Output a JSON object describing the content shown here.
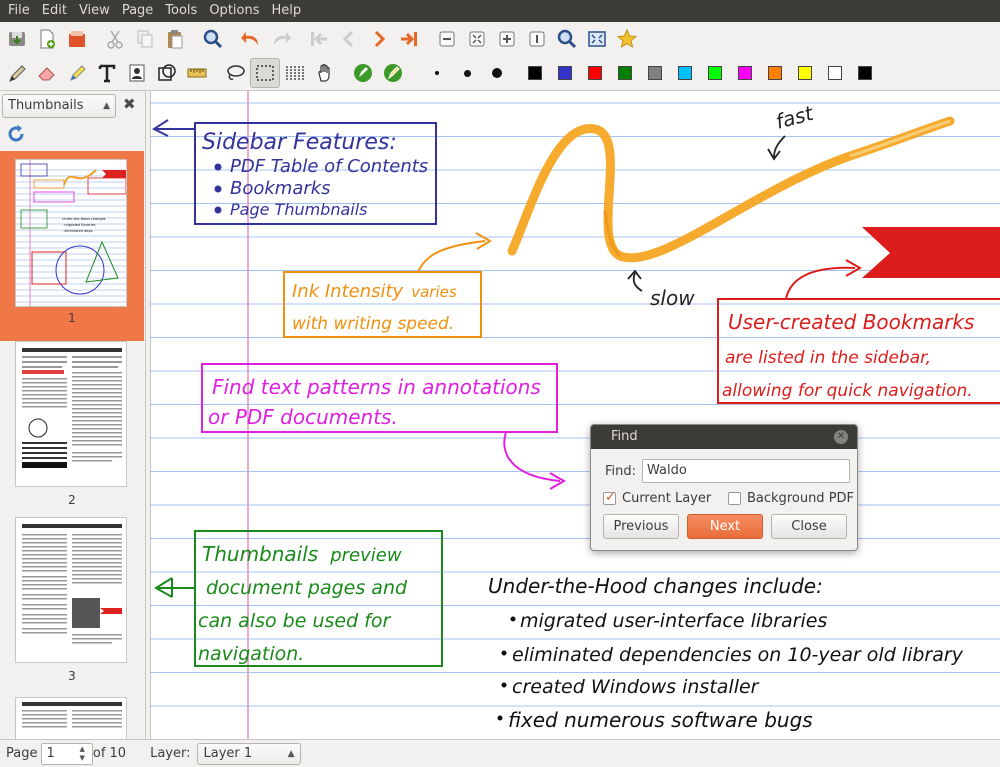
{
  "menu": [
    "File",
    "Edit",
    "View",
    "Page",
    "Tools",
    "Options",
    "Help"
  ],
  "toolbar_icons": {
    "row1": [
      "save-icon",
      "new-page-icon",
      "open-icon",
      "cut-icon",
      "copy-icon",
      "paste-icon",
      "find-icon",
      "undo-icon",
      "redo-icon",
      "first-page-icon",
      "previous-page-icon",
      "next-page-icon",
      "last-page-icon",
      "zoom-out-icon",
      "zoom-fit-icon",
      "zoom-in-icon",
      "zoom-normal-icon",
      "zoom-search-icon",
      "fullscreen-icon",
      "bookmark-star-icon"
    ],
    "row2": [
      "pen-icon",
      "eraser-icon",
      "highlighter-icon",
      "text-icon",
      "image-icon",
      "shape-recognizer-icon",
      "ruler-icon",
      "lasso-select-icon",
      "rect-select-icon",
      "vertical-space-icon",
      "hand-icon",
      "default-pen-icon",
      "default-tool-icon"
    ]
  },
  "pen_colors": [
    "#000000",
    "#3333cc",
    "#ff0000",
    "#008000",
    "#808080",
    "#00c0ff",
    "#00ff00",
    "#ff00ff",
    "#ff8000",
    "#ffff00",
    "#ffffff",
    "#000000"
  ],
  "sidebar": {
    "mode": "Thumbnails",
    "pages": [
      "1",
      "2",
      "3"
    ]
  },
  "notes": {
    "sidebar_box": {
      "title": "Sidebar Features:",
      "items": [
        "PDF Table of Contents",
        "Bookmarks",
        "Page Thumbnails"
      ]
    },
    "fast": "fast",
    "slow": "slow",
    "ink_line1_a": "Ink Intensity",
    "ink_line1_b": "varies",
    "ink_line2": "with writing speed.",
    "find_line1": "Find text patterns in annotations",
    "find_line2": "or PDF documents.",
    "bookmark_title": "User-created Bookmarks",
    "bookmark_line2": "are listed in the sidebar,",
    "bookmark_line3": "allowing for quick navigation.",
    "thumb_line1_a": "Thumbnails",
    "thumb_line1_b": "preview",
    "thumb_line2": "document pages and",
    "thumb_line3": "can also be used for",
    "thumb_line4": "navigation.",
    "hood_title": "Under-the-Hood changes include:",
    "hood_items": [
      "migrated user-interface libraries",
      "eliminated dependencies on 10-year old library",
      "created Windows installer",
      "fixed numerous software bugs"
    ]
  },
  "find_dialog": {
    "title": "Find",
    "find_label": "Find:",
    "find_value": "Waldo",
    "current_layer_label": "Current Layer",
    "current_layer_checked": true,
    "background_pdf_label": "Background PDF",
    "background_pdf_checked": false,
    "previous_label": "Previous",
    "next_label": "Next",
    "close_label": "Close"
  },
  "statusbar": {
    "page_label": "Page",
    "page_value": "1",
    "page_total": "of 10",
    "layer_label": "Layer:",
    "layer_value": "Layer 1"
  }
}
